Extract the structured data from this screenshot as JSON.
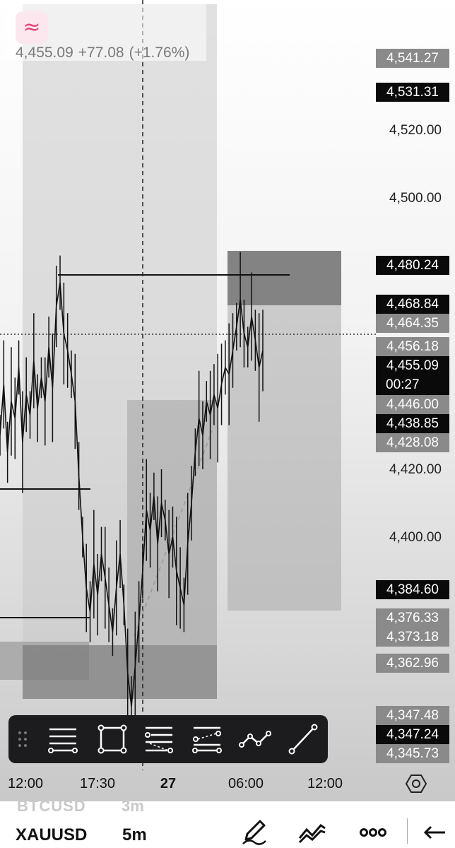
{
  "legend": {
    "symbol_icon": "≈",
    "last_price": "4,455.09",
    "change": "+77.08",
    "change_pct": "(+1.76%)"
  },
  "price_labels": [
    {
      "text": "4,541.27",
      "style": "gray"
    },
    {
      "text": "4,531.31",
      "style": "black"
    },
    {
      "text": "4,520.00",
      "style": "plain"
    },
    {
      "text": "4,500.00",
      "style": "plain"
    },
    {
      "text": "4,480.24",
      "style": "black"
    },
    {
      "text": "4,468.84",
      "style": "black"
    },
    {
      "text": "4,464.35",
      "style": "gray"
    },
    {
      "text": "4,456.18",
      "style": "gray"
    },
    {
      "text": "4,455.09",
      "style": "black"
    },
    {
      "text": "4,446.00",
      "style": "gray"
    },
    {
      "text": "4,438.85",
      "style": "black"
    },
    {
      "text": "4,428.08",
      "style": "gray"
    },
    {
      "text": "4,420.00",
      "style": "plain"
    },
    {
      "text": "4,400.00",
      "style": "plain"
    },
    {
      "text": "4,384.60",
      "style": "black"
    },
    {
      "text": "4,376.33",
      "style": "gray"
    },
    {
      "text": "4,373.18",
      "style": "gray"
    },
    {
      "text": "4,362.96",
      "style": "gray"
    },
    {
      "text": "4,347.48",
      "style": "gray"
    },
    {
      "text": "4,347.24",
      "style": "black"
    },
    {
      "text": "4,345.73",
      "style": "gray"
    }
  ],
  "countdown": "00:27",
  "time_axis": [
    "12:00",
    "17:30",
    "27",
    "06:00",
    "12:00"
  ],
  "drawing_tools": [
    {
      "name": "horizontal-lines-tool"
    },
    {
      "name": "rectangle-tool"
    },
    {
      "name": "fib-retracement-tool"
    },
    {
      "name": "parallel-channel-tool"
    },
    {
      "name": "path-tool"
    },
    {
      "name": "trend-line-tool"
    }
  ],
  "bottom_bar": {
    "ghost_symbol": "BTCUSD",
    "ghost_timeframe": "3m",
    "symbol": "XAUUSD",
    "timeframe": "5m"
  },
  "colors": {
    "candle": "#111111",
    "zone_dark": "#808080",
    "zone_light": "#b0b0b0",
    "accent_pink": "#e0457b"
  },
  "chart_data": {
    "type": "candlestick-line",
    "price_range": [
      4340,
      4545
    ],
    "current_price": 4455.09,
    "series": [
      {
        "values": [
          4430,
          4445,
          4425,
          4440,
          4435,
          4450,
          4428,
          4442,
          4436,
          4452,
          4438,
          4447,
          4440,
          4456,
          4444,
          4468,
          4475,
          4460,
          4455,
          4448,
          4440,
          4418,
          4400,
          4385,
          4378,
          4392,
          4383,
          4395,
          4388,
          4380,
          4372,
          4385,
          4395,
          4380,
          4360,
          4350,
          4362,
          4375,
          4390,
          4408,
          4402,
          4412,
          4398,
          4410,
          4405,
          4395,
          4400,
          4390,
          4385,
          4380,
          4398,
          4410,
          4425,
          4435,
          4430,
          4440,
          4436,
          4442,
          4438,
          4445,
          4450,
          4448,
          4455,
          4462,
          4470,
          4460,
          4456,
          4465,
          4458,
          4450,
          4455
        ]
      }
    ]
  }
}
